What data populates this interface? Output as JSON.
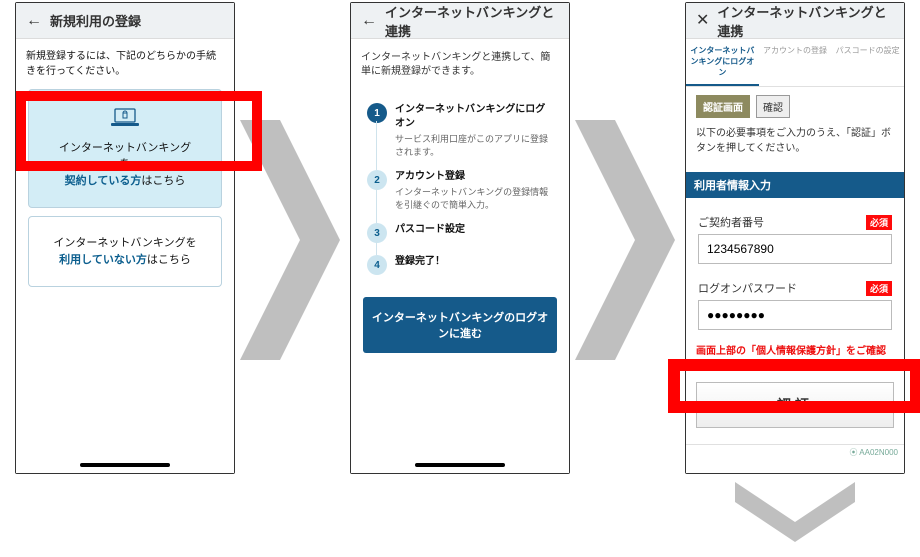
{
  "screen1": {
    "title": "新規利用の登録",
    "instruction": "新規登録するには、下記のどちらかの手続きを行ってください。",
    "card1_line1": "インターネットバンキング",
    "card1_line2": "を",
    "card1_line3_a": "契約している方",
    "card1_line3_b": "はこちら",
    "card2_line1": "インターネットバンキングを",
    "card2_line2_a": "利用していない方",
    "card2_line2_b": "はこちら"
  },
  "screen2": {
    "title": "インターネットバンキングと連携",
    "lead": "インターネットバンキングと連携して、簡単に新規登録ができます。",
    "steps": [
      {
        "num": "1",
        "title": "インターネットバンキングにログオン",
        "desc": "サービス利用口座がこのアプリに登録されます。"
      },
      {
        "num": "2",
        "title": "アカウント登録",
        "desc": "インターネットバンキングの登録情報を引継ぐので簡単入力。"
      },
      {
        "num": "3",
        "title": "パスコード設定",
        "desc": ""
      },
      {
        "num": "4",
        "title": "登録完了！",
        "desc": ""
      }
    ],
    "cta": "インターネットバンキングのログオンに進む"
  },
  "screen3": {
    "title": "インターネットバンキングと連携",
    "tabs": [
      "インターネットバンキングにログオン",
      "アカウントの登録",
      "パスコードの設定"
    ],
    "chip_current": "認証画面",
    "chip_next": "確認",
    "info": "以下の必要事項をご入力のうえ、「認証」ボタンを押してください。",
    "form_header": "利用者情報入力",
    "field1_label": "ご契約者番号",
    "field1_value": "1234567890",
    "field2_label": "ログオンパスワード",
    "field2_value": "●●●●●●●●",
    "required": "必須",
    "warn": "画面上部の「個人情報保護方針」をご確認のうえ、「認証」ボタンを押してください。",
    "auth_btn": "認証",
    "footer_id": "⦿ AA02N000"
  }
}
